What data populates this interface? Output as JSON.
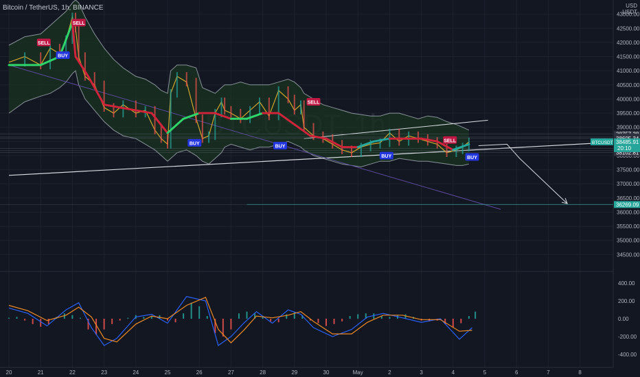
{
  "header": {
    "title": "Bitcoin / TetherUS, 1h, BINANCE",
    "currency_line1": "USD",
    "currency_line2": "USDT"
  },
  "watermark": "BTCUSDT, 1h",
  "colors": {
    "background": "#131722",
    "grid": "#1e222d",
    "band_fill": "#1a3322",
    "band_line": "#a8b0b8",
    "price_line": "#d1a62c",
    "trend_red": "#d0243a",
    "trend_green": "#2fd56a",
    "trend_teal": "#24a69c",
    "macd_line": "#2962ff",
    "signal_line": "#f08a24",
    "hist_pos": "#26a69a",
    "hist_neg": "#ef5350",
    "buy_label": "#2436e0",
    "sell_label": "#c01845",
    "draw_line": "#d8dbe0",
    "purple_line": "#5b4a9e",
    "current_price_bg": "#26a69a"
  },
  "chart_data": {
    "type": "line",
    "x_axis": {
      "tick_labels": [
        "20",
        "21",
        "22",
        "23",
        "24",
        "25",
        "26",
        "27",
        "28",
        "29",
        "30",
        "May",
        "2",
        "3",
        "4",
        "5",
        "6",
        "7",
        "8"
      ]
    },
    "price_axis": {
      "range": [
        34000,
        43500
      ],
      "tick_values": [
        43000,
        42500,
        42000,
        41500,
        41000,
        40500,
        40000,
        39500,
        39000,
        38500,
        38000,
        37500,
        37000,
        36500,
        36000,
        35500,
        35000,
        34500
      ],
      "tick_labels": [
        "43000.00",
        "42500.00",
        "42000.00",
        "41500.00",
        "41000.00",
        "40500.00",
        "40000.00",
        "39500.00",
        "39000.00",
        "38500.00",
        "38000.00",
        "37500.00",
        "37000.00",
        "36500.00",
        "36000.00",
        "35500.00",
        "35000.00",
        "34500.00"
      ]
    },
    "price_labels": [
      {
        "value": 38757.38,
        "text": "38757.38"
      },
      {
        "value": 38654.84,
        "text": "38654.84"
      },
      {
        "value": 38605.34,
        "text": "38605.34"
      },
      {
        "value": 38251.78,
        "text": "38251.78"
      },
      {
        "value": 38174.0,
        "text": "38174.00"
      },
      {
        "value": 38102.81,
        "text": "38102.81"
      },
      {
        "value": 36269.09,
        "text": "36269.09",
        "highlight": true
      }
    ],
    "current_price": {
      "symbol": "BTCUSDT",
      "value": 38485.91,
      "text": "38485.91",
      "countdown": "20:10"
    },
    "price_series": {
      "name": "",
      "x": [
        0,
        0.5,
        1,
        1.3,
        1.6,
        1.8,
        2,
        2.1,
        2.2,
        2.4,
        2.7,
        3,
        3.3,
        3.6,
        4,
        4.3,
        4.6,
        4.8,
        5,
        5.1,
        5.3,
        5.6,
        5.9,
        6.1,
        6.3,
        6.5,
        6.7,
        6.8,
        7,
        7.3,
        7.6,
        7.9,
        8.2,
        8.5,
        8.8,
        9,
        9.2,
        9.3,
        9.6,
        9.9,
        10.2,
        10.5,
        10.8,
        11.1,
        11.4,
        11.7,
        12,
        12.3,
        12.6,
        12.9,
        13.2,
        13.5,
        13.8,
        14.1,
        14.3,
        14.5
      ],
      "values": [
        41300,
        41500,
        41200,
        41800,
        41600,
        42100,
        42900,
        42500,
        41500,
        40800,
        40500,
        39700,
        39500,
        39800,
        39500,
        39600,
        38900,
        38600,
        38400,
        40200,
        40800,
        40600,
        39300,
        38600,
        38700,
        39500,
        39900,
        39600,
        39500,
        39300,
        39600,
        39900,
        39400,
        40300,
        40000,
        39600,
        39800,
        39000,
        38700,
        38600,
        38400,
        38200,
        38100,
        38300,
        38400,
        38450,
        38800,
        38500,
        38700,
        38600,
        38500,
        38400,
        38100,
        38200,
        38300,
        38486
      ]
    },
    "bands": {
      "upper": [
        41900,
        42200,
        42300,
        42600,
        42900,
        43100,
        43400,
        43500,
        43400,
        42900,
        42300,
        41800,
        41400,
        41100,
        40800,
        40700,
        40500,
        40300,
        40200,
        41000,
        41200,
        41200,
        41100,
        40400,
        40300,
        40200,
        40400,
        40500,
        40500,
        40600,
        40500,
        40500,
        40500,
        40600,
        40700,
        40600,
        40400,
        40200,
        40000,
        39800,
        39700,
        39600,
        39500,
        39450,
        39400,
        39400,
        39500,
        39500,
        39400,
        39300,
        39400,
        39350,
        39200,
        39100,
        39000,
        38900
      ],
      "lower": [
        39500,
        39900,
        40100,
        40200,
        40400,
        40600,
        40900,
        41000,
        40500,
        40000,
        39600,
        39200,
        38900,
        38700,
        38600,
        38400,
        38200,
        38000,
        37800,
        37900,
        38100,
        38200,
        38000,
        37800,
        37700,
        37900,
        38100,
        38300,
        38400,
        38300,
        38200,
        38300,
        38300,
        38400,
        38500,
        38400,
        38300,
        38200,
        38000,
        37900,
        37800,
        37700,
        37650,
        37600,
        37700,
        37800,
        37800,
        37900,
        37850,
        37800,
        37800,
        37750,
        37700,
        37650,
        37650,
        37700
      ]
    },
    "trend_line": {
      "x": [
        0,
        1,
        1.6,
        2,
        2.1,
        2.5,
        3,
        3.5,
        4,
        4.5,
        5,
        5.5,
        6,
        6.5,
        7,
        7.5,
        8,
        8.5,
        9,
        9.5,
        10,
        10.5,
        11,
        11.5,
        12,
        12.5,
        13,
        13.5,
        14,
        14.5
      ],
      "values": [
        41200,
        41200,
        41500,
        42700,
        41500,
        40800,
        39800,
        39700,
        39600,
        39500,
        38800,
        39300,
        39500,
        39500,
        39300,
        39300,
        39500,
        39500,
        39100,
        38700,
        38600,
        38300,
        38300,
        38500,
        38600,
        38600,
        38600,
        38500,
        38200,
        38400
      ],
      "state": [
        "green",
        "green",
        "green",
        "green",
        "red",
        "red",
        "red",
        "red",
        "red",
        "red",
        "red",
        "green",
        "green",
        "red",
        "red",
        "green",
        "green",
        "red",
        "red",
        "red",
        "red",
        "red",
        "red",
        "teal",
        "teal",
        "red",
        "red",
        "red",
        "red",
        "teal"
      ]
    },
    "signals": [
      {
        "x": 1.1,
        "value": 42000,
        "text": "SELL",
        "kind": "sell"
      },
      {
        "x": 2.2,
        "value": 42700,
        "text": "SELL",
        "kind": "sell"
      },
      {
        "x": 1.7,
        "value": 41550,
        "text": "BUY",
        "kind": "buy"
      },
      {
        "x": 5.85,
        "value": 38450,
        "text": "BUY",
        "kind": "buy"
      },
      {
        "x": 8.55,
        "value": 38350,
        "text": "BUY",
        "kind": "buy"
      },
      {
        "x": 9.6,
        "value": 39900,
        "text": "SELL",
        "kind": "sell"
      },
      {
        "x": 11.9,
        "value": 38000,
        "text": "BUY",
        "kind": "buy"
      },
      {
        "x": 13.9,
        "value": 38550,
        "text": "SELL",
        "kind": "sell"
      },
      {
        "x": 14.6,
        "value": 37950,
        "text": "BUY",
        "kind": "buy"
      }
    ],
    "drawings": {
      "support_line": {
        "x": [
          0,
          18.7
        ],
        "values": [
          37300,
          38450
        ]
      },
      "upper_line": {
        "x": [
          9.3,
          15.1
        ],
        "values": [
          38600,
          39250
        ]
      },
      "purple_line": {
        "x": [
          0,
          15.5
        ],
        "values": [
          41200,
          36100
        ]
      },
      "projection_path": {
        "x": [
          14.8,
          15.7,
          16.1,
          17.6
        ],
        "values": [
          38350,
          38400,
          37900,
          36300
        ]
      },
      "target_line": {
        "x": [
          7.5,
          19
        ],
        "value": 36269.09
      }
    },
    "macd": {
      "range": [
        -500,
        500
      ],
      "tick_values": [
        400,
        200,
        0,
        -200,
        -400
      ],
      "tick_labels": [
        "400.00",
        "200.00",
        "0.00",
        "-200.00",
        "-400.00"
      ],
      "macd_line": {
        "x": [
          0,
          0.6,
          1.2,
          1.8,
          2.2,
          2.6,
          3.0,
          3.4,
          4.0,
          4.5,
          5.0,
          5.6,
          6.2,
          6.6,
          7.0,
          7.4,
          7.8,
          8.3,
          8.8,
          9.2,
          9.6,
          10.2,
          10.8,
          11.3,
          11.8,
          12.4,
          13.0,
          13.6,
          14.2,
          14.6
        ],
        "values": [
          120,
          60,
          -80,
          100,
          180,
          -100,
          -300,
          -220,
          20,
          50,
          -50,
          250,
          200,
          -300,
          -200,
          -50,
          80,
          -50,
          100,
          50,
          -100,
          -200,
          -120,
          20,
          60,
          10,
          -40,
          0,
          -230,
          -100
        ]
      },
      "signal_line": {
        "x": [
          0,
          0.6,
          1.2,
          1.8,
          2.2,
          2.6,
          3.0,
          3.4,
          4.0,
          4.5,
          5.0,
          5.6,
          6.2,
          6.6,
          7.0,
          7.4,
          7.8,
          8.3,
          8.8,
          9.2,
          9.6,
          10.2,
          10.8,
          11.3,
          11.8,
          12.4,
          13.0,
          13.6,
          14.2,
          14.6
        ],
        "values": [
          150,
          90,
          -20,
          40,
          130,
          20,
          -220,
          -260,
          -60,
          30,
          0,
          150,
          240,
          -120,
          -270,
          -130,
          30,
          10,
          40,
          80,
          -30,
          -170,
          -170,
          -40,
          40,
          40,
          -10,
          -10,
          -140,
          -130
        ]
      },
      "histogram": {
        "x": [
          0,
          0.25,
          0.5,
          0.75,
          1,
          1.25,
          1.5,
          1.75,
          2,
          2.25,
          2.5,
          2.75,
          3,
          3.25,
          3.5,
          3.75,
          4,
          4.25,
          4.5,
          4.75,
          5,
          5.25,
          5.5,
          5.75,
          6,
          6.25,
          6.5,
          6.75,
          7,
          7.25,
          7.5,
          7.75,
          8,
          8.25,
          8.5,
          8.75,
          9,
          9.25,
          9.5,
          9.75,
          10,
          10.25,
          10.5,
          10.75,
          11,
          11.25,
          11.5,
          11.75,
          12,
          12.25,
          12.5,
          12.75,
          13,
          13.25,
          13.5,
          13.75,
          14,
          14.25,
          14.5,
          14.7
        ],
        "values": [
          10,
          20,
          -20,
          -60,
          -90,
          -60,
          20,
          60,
          40,
          10,
          -120,
          -180,
          -120,
          -60,
          -20,
          10,
          40,
          20,
          30,
          40,
          -20,
          -40,
          60,
          180,
          140,
          30,
          -160,
          -200,
          -120,
          60,
          80,
          60,
          30,
          -30,
          -40,
          50,
          70,
          40,
          -20,
          -50,
          -80,
          -60,
          -30,
          30,
          50,
          60,
          60,
          30,
          20,
          40,
          50,
          20,
          -20,
          -30,
          -20,
          -60,
          -100,
          -50,
          30,
          80
        ]
      }
    }
  }
}
